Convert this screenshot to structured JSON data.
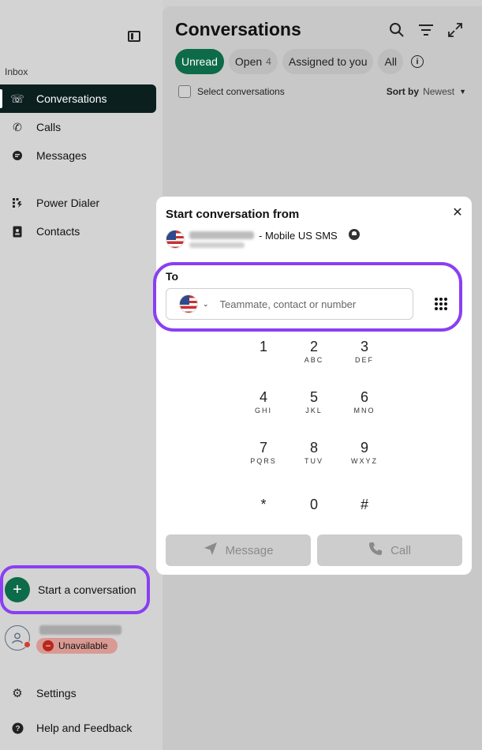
{
  "sidebar": {
    "section_label": "Inbox",
    "items": [
      {
        "label": "Conversations",
        "icon": "phone-chat-icon",
        "active": true
      },
      {
        "label": "Calls",
        "icon": "phone-icon"
      },
      {
        "label": "Messages",
        "icon": "message-icon"
      },
      {
        "label": "Power Dialer",
        "icon": "power-dialer-icon"
      },
      {
        "label": "Contacts",
        "icon": "contacts-icon"
      }
    ],
    "start_conversation": "Start a conversation",
    "user_status": "Unavailable",
    "settings": "Settings",
    "help": "Help and Feedback"
  },
  "main": {
    "title": "Conversations",
    "filters": {
      "unread": "Unread",
      "open": "Open",
      "open_count": "4",
      "assigned": "Assigned to you",
      "all": "All"
    },
    "select_label": "Select conversations",
    "sort_label": "Sort by",
    "sort_value": "Newest"
  },
  "dialog": {
    "title": "Start conversation from",
    "from_suffix": "- Mobile US SMS",
    "to_label": "To",
    "to_placeholder": "Teammate, contact or number",
    "keys": [
      {
        "digit": "1",
        "letters": ""
      },
      {
        "digit": "2",
        "letters": "ABC"
      },
      {
        "digit": "3",
        "letters": "DEF"
      },
      {
        "digit": "4",
        "letters": "GHI"
      },
      {
        "digit": "5",
        "letters": "JKL"
      },
      {
        "digit": "6",
        "letters": "MNO"
      },
      {
        "digit": "7",
        "letters": "PQRS"
      },
      {
        "digit": "8",
        "letters": "TUV"
      },
      {
        "digit": "9",
        "letters": "WXYZ"
      },
      {
        "digit": "*",
        "letters": ""
      },
      {
        "digit": "0",
        "letters": ""
      },
      {
        "digit": "#",
        "letters": ""
      }
    ],
    "message_button": "Message",
    "call_button": "Call"
  },
  "colors": {
    "brand_green": "#0d6b4a",
    "highlight_purple": "#8a3ff2",
    "active_nav": "#0b1f1f",
    "unavailable_red": "#b8271b"
  }
}
